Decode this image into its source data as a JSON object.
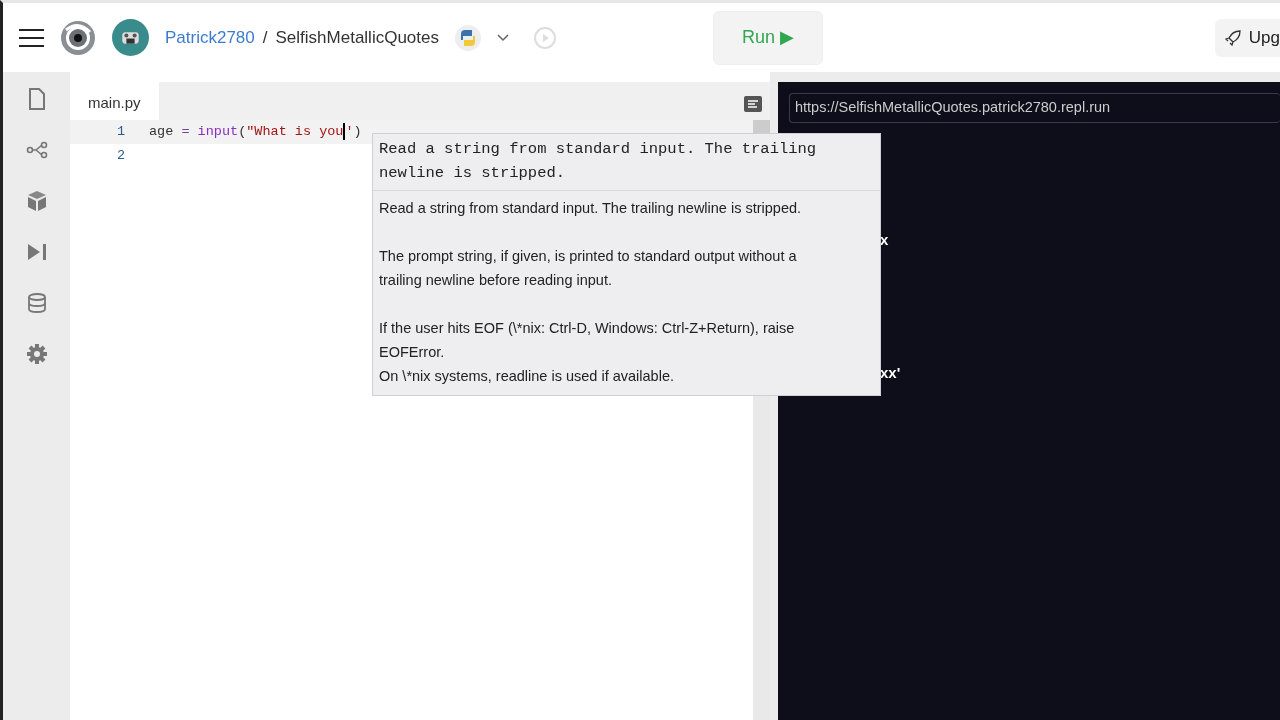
{
  "header": {
    "user": "Patrick2780",
    "separator": "/",
    "repl_name": "SelfishMetallicQuotes",
    "run_label": "Run ▶",
    "upgrade_label": "Upg"
  },
  "editor": {
    "tab": "main.py",
    "lines": [
      {
        "number": "1",
        "current": true,
        "tokens": [
          {
            "kind": "name",
            "text": "age"
          },
          {
            "kind": "operator",
            "text": "="
          },
          {
            "kind": "builtin",
            "text": "input"
          },
          {
            "kind": "punct",
            "text": "("
          },
          {
            "kind": "string",
            "text": "\"What is you"
          },
          {
            "kind": "cursor"
          },
          {
            "kind": "string",
            "text": "'"
          },
          {
            "kind": "punct",
            "text": ")"
          }
        ]
      },
      {
        "number": "2",
        "current": false
      }
    ]
  },
  "tooltip": {
    "signature": "Read a string from standard input. The trailing\nnewline is stripped.",
    "paragraphs": [
      "Read a string from standard input.  The trailing newline is stripped.",
      "The prompt string, if given, is printed to standard output without a\ntrailing newline before reading input.",
      "If the user hits EOF (\\*nix: Ctrl-D, Windows: Ctrl-Z+Return), raise\nEOFError.\nOn \\*nix systems, readline is used if available."
    ]
  },
  "console": {
    "url": "https://SelfishMetallicQuotes.patrick2780.repl.run",
    "fragments": [
      "x",
      "xx'"
    ]
  }
}
